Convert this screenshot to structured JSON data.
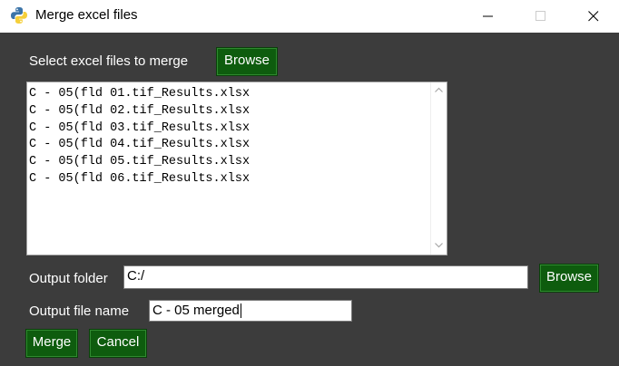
{
  "window": {
    "title": "Merge excel files"
  },
  "file_select": {
    "label": "Select excel files to merge",
    "browse_label": "Browse"
  },
  "file_list": [
    "C - 05(fld 01.tif_Results.xlsx",
    "C - 05(fld 02.tif_Results.xlsx",
    "C - 05(fld 03.tif_Results.xlsx",
    "C - 05(fld 04.tif_Results.xlsx",
    "C - 05(fld 05.tif_Results.xlsx",
    "C - 05(fld 06.tif_Results.xlsx"
  ],
  "output_folder": {
    "label": "Output folder",
    "value": "C:/",
    "browse_label": "Browse"
  },
  "output_file_name": {
    "label": "Output file name",
    "value": "C - 05 merged"
  },
  "actions": {
    "merge_label": "Merge",
    "cancel_label": "Cancel"
  },
  "colors": {
    "window_background": "#3c3c3c",
    "button_green": "#0e5c0e",
    "title_bar": "#ffffff"
  },
  "icons": {
    "app": "python-logo-icon",
    "minimize": "minimize-icon",
    "maximize": "maximize-icon",
    "close": "close-icon",
    "scroll_up": "chevron-up-icon",
    "scroll_down": "chevron-down-icon"
  }
}
